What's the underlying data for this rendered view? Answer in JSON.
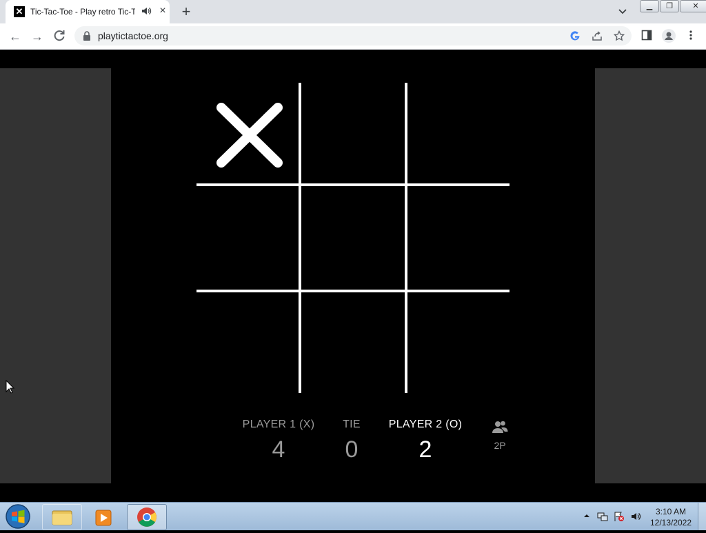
{
  "browser": {
    "tab": {
      "favicon": "x-logo-icon",
      "title": "Tic-Tac-Toe - Play retro Tic-Tac-Toe",
      "audio_icon": "speaker-icon"
    },
    "url": "playtictactoe.org",
    "window_controls": [
      "minimize",
      "restore",
      "close"
    ]
  },
  "game": {
    "board": [
      [
        "X",
        "",
        ""
      ],
      [
        "",
        "",
        ""
      ],
      [
        "",
        "",
        ""
      ]
    ],
    "scores": [
      {
        "label": "PLAYER 1 (X)",
        "value": "4",
        "active": false
      },
      {
        "label": "TIE",
        "value": "0",
        "active": false
      },
      {
        "label": "PLAYER 2 (O)",
        "value": "2",
        "active": true
      }
    ],
    "mode": {
      "icon": "two-players-icon",
      "label": "2P"
    }
  },
  "colors": {
    "page_bg": "#000000",
    "side_panel": "#333333",
    "line": "#ffffff",
    "inactive_text": "#9a9a9a",
    "active_text": "#ffffff"
  },
  "taskbar": {
    "items": [
      "file-explorer-icon",
      "media-player-icon",
      "chrome-icon"
    ],
    "clock_time": "3:10 AM",
    "clock_date": "12/13/2022"
  }
}
